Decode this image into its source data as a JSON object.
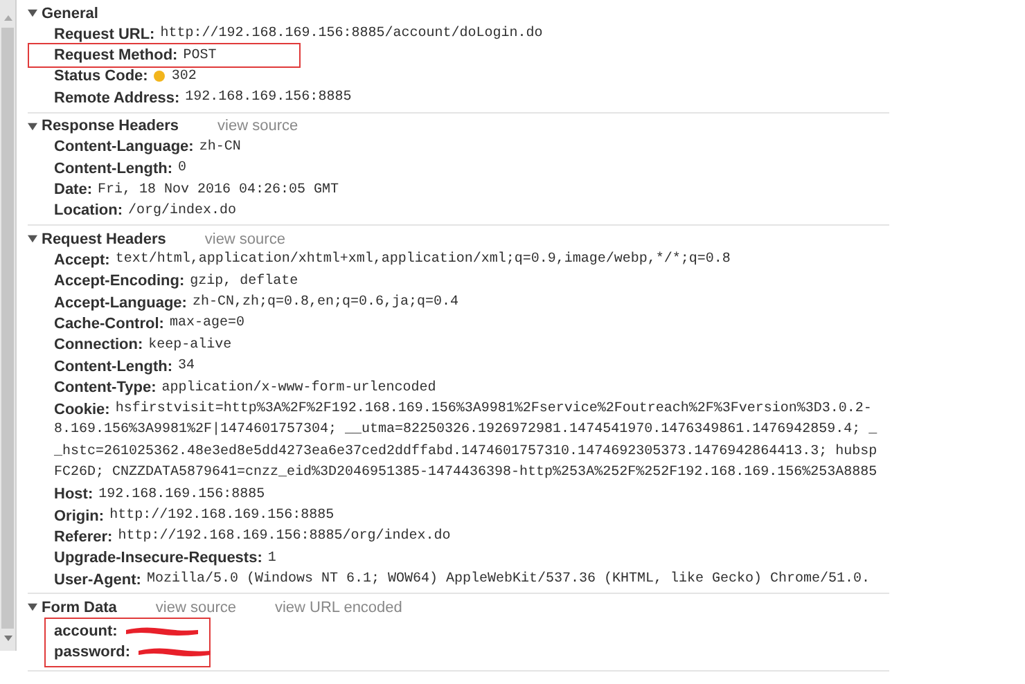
{
  "sections": [
    {
      "title": "General",
      "expanded": true,
      "rows": [
        {
          "kind": "text",
          "key": "Request URL:",
          "value": "http://192.168.169.156:8885/account/doLogin.do",
          "highlighted": false
        },
        {
          "kind": "text",
          "key": "Request Method:",
          "value": "POST",
          "highlighted": true
        },
        {
          "kind": "status",
          "key": "Status Code:",
          "value": "302",
          "color": "#f2b51c",
          "highlighted": false
        },
        {
          "kind": "text",
          "key": "Remote Address:",
          "value": "192.168.169.156:8885",
          "highlighted": false
        }
      ]
    },
    {
      "title": "Response Headers",
      "expanded": true,
      "links": [
        "view source"
      ],
      "rows": [
        {
          "kind": "text",
          "key": "Content-Language:",
          "value": "zh-CN",
          "highlighted": false
        },
        {
          "kind": "text",
          "key": "Content-Length:",
          "value": "0",
          "highlighted": false
        },
        {
          "kind": "text",
          "key": "Date:",
          "value": "Fri, 18 Nov 2016 04:26:05 GMT",
          "highlighted": false
        },
        {
          "kind": "text",
          "key": "Location:",
          "value": "/org/index.do",
          "highlighted": false
        }
      ]
    },
    {
      "title": "Request Headers",
      "expanded": true,
      "links": [
        "view source"
      ],
      "rows": [
        {
          "kind": "text",
          "key": "Accept:",
          "value": "text/html,application/xhtml+xml,application/xml;q=0.9,image/webp,*/*;q=0.8",
          "highlighted": false
        },
        {
          "kind": "text",
          "key": "Accept-Encoding:",
          "value": "gzip, deflate",
          "highlighted": false
        },
        {
          "kind": "text",
          "key": "Accept-Language:",
          "value": "zh-CN,zh;q=0.8,en;q=0.6,ja;q=0.4",
          "highlighted": false
        },
        {
          "kind": "text",
          "key": "Cache-Control:",
          "value": "max-age=0",
          "highlighted": false
        },
        {
          "kind": "text",
          "key": "Connection:",
          "value": "keep-alive",
          "highlighted": false
        },
        {
          "kind": "text",
          "key": "Content-Length:",
          "value": "34",
          "highlighted": false
        },
        {
          "kind": "text",
          "key": "Content-Type:",
          "value": "application/x-www-form-urlencoded",
          "highlighted": false
        },
        {
          "kind": "wrapped",
          "key": "Cookie:",
          "highlighted": false,
          "lines": [
            "hsfirstvisit=http%3A%2F%2F192.168.169.156%3A9981%2Fservice%2Foutreach%2F%3Fversion%3D3.0.2-",
            "8.169.156%3A9981%2F|1474601757304; __utma=82250326.1926972981.1474541970.1476349861.1476942859.4; _",
            "_hstc=261025362.48e3ed8e5dd4273ea6e37ced2ddffabd.1474601757310.1474692305373.1476942864413.3; hubsp",
            "FC26D; CNZZDATA5879641=cnzz_eid%3D2046951385-1474436398-http%253A%252F%252F192.168.169.156%253A8885"
          ]
        },
        {
          "kind": "text",
          "key": "Host:",
          "value": "192.168.169.156:8885",
          "highlighted": false
        },
        {
          "kind": "text",
          "key": "Origin:",
          "value": "http://192.168.169.156:8885",
          "highlighted": false
        },
        {
          "kind": "text",
          "key": "Referer:",
          "value": "http://192.168.169.156:8885/org/index.do",
          "highlighted": false
        },
        {
          "kind": "text",
          "key": "Upgrade-Insecure-Requests:",
          "value": "1",
          "highlighted": false
        },
        {
          "kind": "text",
          "key": "User-Agent:",
          "value": "Mozilla/5.0 (Windows NT 6.1; WOW64) AppleWebKit/537.36 (KHTML, like Gecko) Chrome/51.0.",
          "highlighted": false
        }
      ]
    },
    {
      "title": "Form Data",
      "expanded": true,
      "links": [
        "view source",
        "view URL encoded"
      ],
      "highlighted": true,
      "rows": [
        {
          "kind": "redacted",
          "key": "account:"
        },
        {
          "kind": "redacted",
          "key": "password:"
        }
      ]
    }
  ]
}
